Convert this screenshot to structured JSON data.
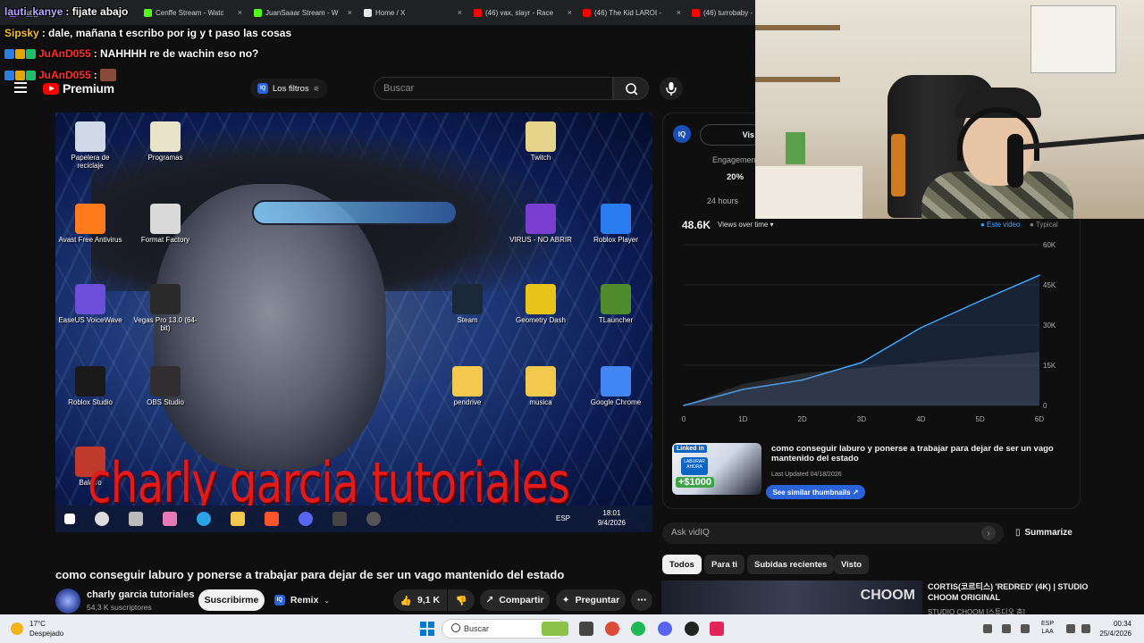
{
  "browser": {
    "tabs": [
      {
        "label": "lauti_kanye",
        "favicon_color": "#9146ff"
      },
      {
        "label": "Cenffe Stream - Watc",
        "favicon_color": "#53fc18"
      },
      {
        "label": "JuanSaaar Stream - W",
        "favicon_color": "#53fc18"
      },
      {
        "label": "Home / X",
        "favicon_color": "#e7e7e7"
      },
      {
        "label": "(46) vax, slayr - Race",
        "favicon_color": "#ff0000"
      },
      {
        "label": "(46) The Kid LAROI -",
        "favicon_color": "#ff0000"
      },
      {
        "label": "(46) turrobaby -",
        "favicon_color": "#ff0000"
      }
    ],
    "close_glyph": "×"
  },
  "chat": {
    "messages": [
      {
        "user": "lauti_kanye",
        "text": ": fijate abajo",
        "user_color": "#b8a8ff"
      },
      {
        "user": "Sipsky",
        "text": ": dale, mañana t escribo por ig y t paso las cosas",
        "user_color": "#f3c131"
      },
      {
        "user": "JuAnD055",
        "text": ": NAHHHH re de wachin eso no?",
        "user_color": "#ff3030"
      },
      {
        "user": "JuAnD055",
        "text": ":",
        "user_color": "#ff3030"
      }
    ]
  },
  "youtube": {
    "logo_text": "Premium",
    "filter_chip": "Los filtros",
    "search_placeholder": "Buscar",
    "video": {
      "overlay_title": "charly garcia tutoriales",
      "desktop_icons": [
        {
          "label": "Papelera de reciclaje",
          "color": "#cfd8e6"
        },
        {
          "label": "Programas",
          "color": "#e8e2c9"
        },
        {
          "label": "Twitch",
          "color": "#e6d48a"
        },
        {
          "label": "Avast Free Antivirus",
          "color": "#ff7a1a"
        },
        {
          "label": "Format Factory",
          "color": "#d9d9d9"
        },
        {
          "label": "VIRUS - NO ABRIR",
          "color": "#7a3fd1"
        },
        {
          "label": "Roblox Player",
          "color": "#2b7cf0"
        },
        {
          "label": "EaseUS VoiceWave",
          "color": "#6b4fd8"
        },
        {
          "label": "Vegas Pro 13.0 (64-bit)",
          "color": "#2a2a2a"
        },
        {
          "label": "Steam",
          "color": "#1b2838"
        },
        {
          "label": "Geometry Dash",
          "color": "#e8c41a"
        },
        {
          "label": "TLauncher",
          "color": "#4f8a2c"
        },
        {
          "label": "Roblox Studio",
          "color": "#1a1a1a"
        },
        {
          "label": "OBS Studio",
          "color": "#302e31"
        },
        {
          "label": "pendrive",
          "color": "#f2c94c"
        },
        {
          "label": "musica",
          "color": "#f2c94c"
        },
        {
          "label": "Google Chrome",
          "color": "#4285f4"
        },
        {
          "label": "Balatro",
          "color": "#c0392b"
        }
      ],
      "inner_taskbar": {
        "lang": "ESP",
        "time": "18:01",
        "date": "9/4/2026"
      }
    },
    "title": "como conseguir laburo y ponerse a trabajar para dejar de ser un vago mantenido del estado",
    "channel": {
      "name": "charly garcia tutoriales",
      "subscribers": "54,3 K suscriptores"
    },
    "buttons": {
      "subscribe": "Suscribirme",
      "remix": "Remix",
      "likes": "9,1 K",
      "share": "Compartir",
      "ask": "Preguntar",
      "more": "⋯"
    }
  },
  "vidiq": {
    "logo": "IQ",
    "toggle_label": "Vis",
    "engagement_label": "Engagement",
    "engagement_value": "20%",
    "hours_label": "24 hours",
    "views_total": "48.6K",
    "views_dropdown": "Views over time ▾",
    "legend_this": "● Este video",
    "legend_typical": "● Typical",
    "thumbnail": {
      "linkedin": "Linked in",
      "badge": "LABURAR AHORA",
      "money": "+$1000",
      "title": "como conseguir laburo y ponerse a trabajar para dejar de ser un vago mantenido del estado",
      "updated": "Last Updated 04/18/2026",
      "see_similar": "See similar thumbnails ↗"
    },
    "ask_placeholder": "Ask vidIQ",
    "summarize": "Summarize"
  },
  "chart_data": {
    "type": "area",
    "x": [
      "0",
      "1D",
      "2D",
      "3D",
      "4D",
      "5D",
      "6D"
    ],
    "x_values": [
      0,
      1,
      2,
      3,
      4,
      5,
      6
    ],
    "ylim": [
      0,
      60000
    ],
    "y_ticks": [
      "0",
      "15K",
      "30K",
      "45K",
      "60K"
    ],
    "y_tick_values": [
      0,
      15000,
      30000,
      45000,
      60000
    ],
    "series": [
      {
        "name": "Este video",
        "color": "#3ea6ff",
        "x": [
          0,
          1,
          2,
          3,
          4,
          5,
          6
        ],
        "values": [
          0,
          6000,
          9500,
          16000,
          29000,
          39000,
          48600
        ]
      },
      {
        "name": "Typical",
        "color": "#555a66",
        "x": [
          0,
          1,
          2,
          3,
          4,
          5,
          6
        ],
        "values": [
          0,
          8000,
          12000,
          14000,
          16000,
          18000,
          20000
        ]
      }
    ],
    "grid": true,
    "legend": "top-right"
  },
  "feed": {
    "chips": [
      "Todos",
      "Para ti",
      "Subidas recientes",
      "Visto"
    ],
    "active_chip": "Todos",
    "recommended": {
      "title": "CORTIS(코르티스) 'REDRED' (4K) | STUDIO CHOOM ORIGINAL",
      "channel": "STUDIO CHOOM [스튜디오 춤]",
      "thumb_text": "CHOOM"
    }
  },
  "taskbar": {
    "weather_temp": "17°C",
    "weather_desc": "Despejado",
    "search_label": "Buscar",
    "lang_top": "ESP",
    "lang_bottom": "LAA",
    "time": "00:34",
    "date": "25/4/2026"
  }
}
